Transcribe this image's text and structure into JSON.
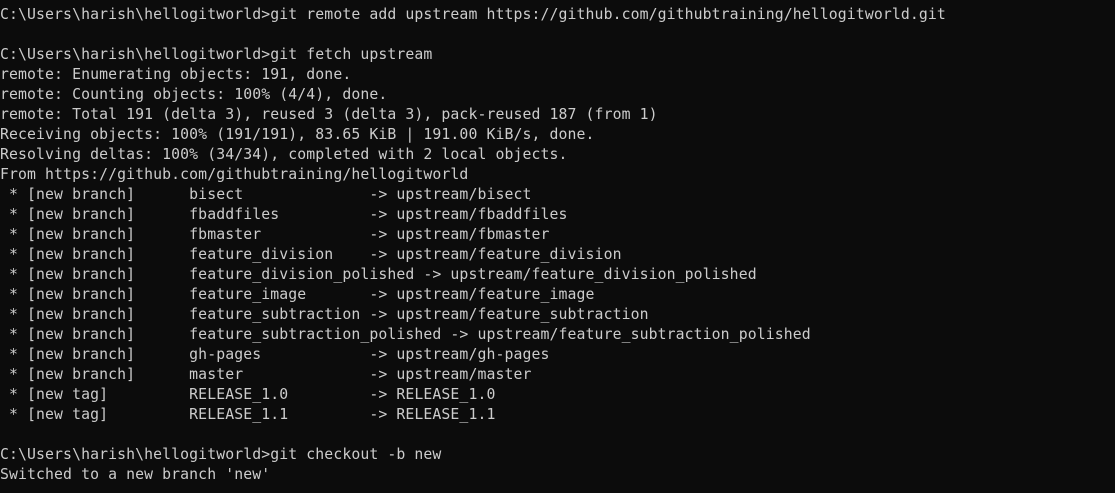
{
  "terminal": {
    "lines": [
      "C:\\Users\\harish\\hellogitworld>git remote add upstream https://github.com/githubtraining/hellogitworld.git",
      "",
      "C:\\Users\\harish\\hellogitworld>git fetch upstream",
      "remote: Enumerating objects: 191, done.",
      "remote: Counting objects: 100% (4/4), done.",
      "remote: Total 191 (delta 3), reused 3 (delta 3), pack-reused 187 (from 1)",
      "Receiving objects: 100% (191/191), 83.65 KiB | 191.00 KiB/s, done.",
      "Resolving deltas: 100% (34/34), completed with 2 local objects.",
      "From https://github.com/githubtraining/hellogitworld",
      " * [new branch]      bisect              -> upstream/bisect",
      " * [new branch]      fbaddfiles          -> upstream/fbaddfiles",
      " * [new branch]      fbmaster            -> upstream/fbmaster",
      " * [new branch]      feature_division    -> upstream/feature_division",
      " * [new branch]      feature_division_polished -> upstream/feature_division_polished",
      " * [new branch]      feature_image       -> upstream/feature_image",
      " * [new branch]      feature_subtraction -> upstream/feature_subtraction",
      " * [new branch]      feature_subtraction_polished -> upstream/feature_subtraction_polished",
      " * [new branch]      gh-pages            -> upstream/gh-pages",
      " * [new branch]      master              -> upstream/master",
      " * [new tag]         RELEASE_1.0         -> RELEASE_1.0",
      " * [new tag]         RELEASE_1.1         -> RELEASE_1.1",
      "",
      "C:\\Users\\harish\\hellogitworld>git checkout -b new",
      "Switched to a new branch 'new'"
    ]
  }
}
